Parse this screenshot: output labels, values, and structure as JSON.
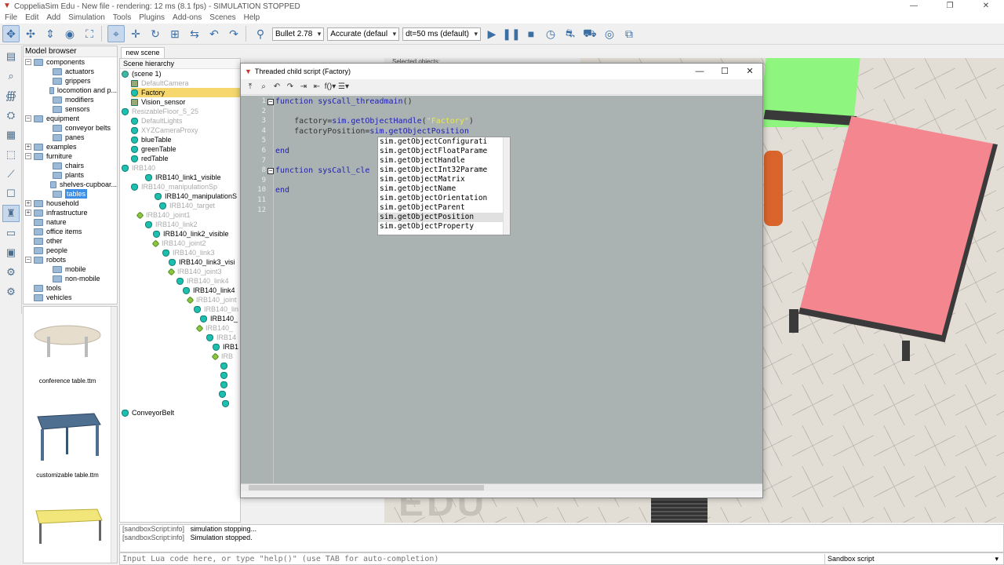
{
  "window": {
    "title": "CoppeliaSim Edu - New file - rendering: 12 ms (8.1 fps) - SIMULATION STOPPED",
    "controls": [
      "—",
      "❐",
      "✕"
    ]
  },
  "menu": [
    "File",
    "Edit",
    "Add",
    "Simulation",
    "Tools",
    "Plugins",
    "Add-ons",
    "Scenes",
    "Help"
  ],
  "toolbar": {
    "engine": "Bullet 2.78",
    "accuracy": "Accurate (defaul",
    "dt": "dt=50 ms (default)"
  },
  "model_browser": {
    "header": "Model browser",
    "items": [
      {
        "label": "components",
        "depth": 0,
        "expander": "−"
      },
      {
        "label": "actuators",
        "depth": 1,
        "expander": ""
      },
      {
        "label": "grippers",
        "depth": 1,
        "expander": ""
      },
      {
        "label": "locomotion and p...",
        "depth": 1,
        "expander": ""
      },
      {
        "label": "modifiers",
        "depth": 1,
        "expander": ""
      },
      {
        "label": "sensors",
        "depth": 1,
        "expander": ""
      },
      {
        "label": "equipment",
        "depth": 0,
        "expander": "−"
      },
      {
        "label": "conveyor belts",
        "depth": 1,
        "expander": ""
      },
      {
        "label": "panes",
        "depth": 1,
        "expander": ""
      },
      {
        "label": "examples",
        "depth": 0,
        "expander": "+"
      },
      {
        "label": "furniture",
        "depth": 0,
        "expander": "−"
      },
      {
        "label": "chairs",
        "depth": 1,
        "expander": ""
      },
      {
        "label": "plants",
        "depth": 1,
        "expander": ""
      },
      {
        "label": "shelves-cupboar...",
        "depth": 1,
        "expander": ""
      },
      {
        "label": "tables",
        "depth": 1,
        "expander": "",
        "selected": true
      },
      {
        "label": "household",
        "depth": 0,
        "expander": "+"
      },
      {
        "label": "infrastructure",
        "depth": 0,
        "expander": "+"
      },
      {
        "label": "nature",
        "depth": 0,
        "expander": ""
      },
      {
        "label": "office items",
        "depth": 0,
        "expander": ""
      },
      {
        "label": "other",
        "depth": 0,
        "expander": ""
      },
      {
        "label": "people",
        "depth": 0,
        "expander": ""
      },
      {
        "label": "robots",
        "depth": 0,
        "expander": "−"
      },
      {
        "label": "mobile",
        "depth": 1,
        "expander": ""
      },
      {
        "label": "non-mobile",
        "depth": 1,
        "expander": ""
      },
      {
        "label": "tools",
        "depth": 0,
        "expander": ""
      },
      {
        "label": "vehicles",
        "depth": 0,
        "expander": ""
      }
    ],
    "thumbnails": [
      {
        "caption": "conference table.ttm"
      },
      {
        "caption": "customizable table.ttm"
      },
      {
        "caption": ""
      }
    ]
  },
  "scene": {
    "tab": "new scene",
    "header": "Scene hierarchy",
    "rows": [
      {
        "label": "(scene 1)",
        "icon": "scene",
        "dim": false
      },
      {
        "label": "DefaultCamera",
        "icon": "cam",
        "dim": true
      },
      {
        "label": "Factory",
        "icon": "shape",
        "dim": false,
        "selected": true
      },
      {
        "label": "Vision_sensor",
        "icon": "cam",
        "dim": false
      },
      {
        "label": "ResizableFloor_5_25",
        "icon": "shape",
        "dim": true
      },
      {
        "label": "DefaultLights",
        "icon": "shape",
        "dim": true
      },
      {
        "label": "XYZCameraProxy",
        "icon": "shape",
        "dim": true
      },
      {
        "label": "blueTable",
        "icon": "shape",
        "dim": false
      },
      {
        "label": "greenTable",
        "icon": "shape",
        "dim": false
      },
      {
        "label": "redTable",
        "icon": "shape",
        "dim": false
      },
      {
        "label": "IRB140",
        "icon": "shape",
        "dim": true
      },
      {
        "label": "IRB140_link1_visible",
        "icon": "shape",
        "dim": false
      },
      {
        "label": "IRB140_manipulationSp",
        "icon": "shape",
        "dim": true
      },
      {
        "label": "IRB140_manipulationS",
        "icon": "shape",
        "dim": false
      },
      {
        "label": "IRB140_target",
        "icon": "shape",
        "dim": true
      },
      {
        "label": "IRB140_joint1",
        "icon": "joint",
        "dim": true
      },
      {
        "label": "IRB140_link2",
        "icon": "shape",
        "dim": true
      },
      {
        "label": "IRB140_link2_visible",
        "icon": "shape",
        "dim": false
      },
      {
        "label": "IRB140_joint2",
        "icon": "joint",
        "dim": true
      },
      {
        "label": "IRB140_link3",
        "icon": "shape",
        "dim": true
      },
      {
        "label": "IRB140_link3_visi",
        "icon": "shape",
        "dim": false
      },
      {
        "label": "IRB140_joint3",
        "icon": "joint",
        "dim": true
      },
      {
        "label": "IRB140_link4",
        "icon": "shape",
        "dim": true
      },
      {
        "label": "IRB140_link4",
        "icon": "shape",
        "dim": false
      },
      {
        "label": "IRB140_joint",
        "icon": "joint",
        "dim": true
      },
      {
        "label": "IRB140_lin",
        "icon": "shape",
        "dim": true
      },
      {
        "label": "IRB140_",
        "icon": "shape",
        "dim": false
      },
      {
        "label": "IRB140_",
        "icon": "joint",
        "dim": true
      },
      {
        "label": "IRB14",
        "icon": "shape",
        "dim": true
      },
      {
        "label": "IRB1",
        "icon": "shape",
        "dim": false
      },
      {
        "label": "IRB",
        "icon": "joint",
        "dim": true
      },
      {
        "label": "",
        "icon": "shape",
        "dim": false
      },
      {
        "label": "",
        "icon": "shape",
        "dim": false
      },
      {
        "label": "",
        "icon": "shape",
        "dim": false
      },
      {
        "label": "",
        "icon": "shape",
        "dim": false
      },
      {
        "label": "",
        "icon": "shape",
        "dim": false
      },
      {
        "label": "ConveyorBelt",
        "icon": "shape",
        "dim": false
      }
    ]
  },
  "viewport": {
    "selection_header": "Selected objects:",
    "watermark": "EDU"
  },
  "script_window": {
    "title": "Threaded child script (Factory)",
    "lines": [
      {
        "n": "1",
        "fold": "−",
        "code": [
          {
            "t": "function ",
            "c": "kw"
          },
          {
            "t": "sysCall_threadmain",
            "c": "fn"
          },
          {
            "t": "()",
            "c": ""
          }
        ]
      },
      {
        "n": "2",
        "fold": "",
        "code": []
      },
      {
        "n": "3",
        "fold": "",
        "code": [
          {
            "t": "    factory=",
            "c": ""
          },
          {
            "t": "sim.getObjectHandle",
            "c": "fn"
          },
          {
            "t": "(",
            "c": ""
          },
          {
            "t": "\"Factory\"",
            "c": "str"
          },
          {
            "t": ")",
            "c": ""
          }
        ]
      },
      {
        "n": "4",
        "fold": "",
        "code": [
          {
            "t": "    factoryPosition=",
            "c": ""
          },
          {
            "t": "sim.getObjectPosition",
            "c": "fn"
          }
        ]
      },
      {
        "n": "5",
        "fold": "",
        "code": []
      },
      {
        "n": "6",
        "fold": "",
        "code": [
          {
            "t": "end",
            "c": "kw"
          }
        ]
      },
      {
        "n": "7",
        "fold": "",
        "code": []
      },
      {
        "n": "8",
        "fold": "−",
        "code": [
          {
            "t": "function ",
            "c": "kw"
          },
          {
            "t": "sysCall_cle",
            "c": "fn"
          }
        ]
      },
      {
        "n": "9",
        "fold": "",
        "code": []
      },
      {
        "n": "10",
        "fold": "",
        "code": [
          {
            "t": "end",
            "c": "kw"
          }
        ]
      },
      {
        "n": "11",
        "fold": "",
        "code": []
      },
      {
        "n": "12",
        "fold": "",
        "code": []
      }
    ],
    "autocomplete": [
      "sim.getObjectConfigurati",
      "sim.getObjectFloatParame",
      "sim.getObjectHandle",
      "sim.getObjectInt32Parame",
      "sim.getObjectMatrix",
      "sim.getObjectName",
      "sim.getObjectOrientation",
      "sim.getObjectParent",
      "sim.getObjectPosition",
      "sim.getObjectProperty"
    ],
    "autocomplete_selected": 8
  },
  "console": {
    "lines": [
      {
        "src": "[sandboxScript:info]",
        "msg": "simulation stopping..."
      },
      {
        "src": "[sandboxScript:info]",
        "msg": "Simulation stopped."
      }
    ],
    "placeholder": "Input Lua code here, or type \"help()\" (use TAB for auto-completion)",
    "script_selector": "Sandbox script"
  },
  "colors": {
    "editor_bg": "#aab3b2",
    "keyword": "#1f1fb0",
    "string": "#e8e84a",
    "selection": "#f5d76e",
    "table_pink": "#f4868f",
    "table_green": "#8ef57e"
  }
}
